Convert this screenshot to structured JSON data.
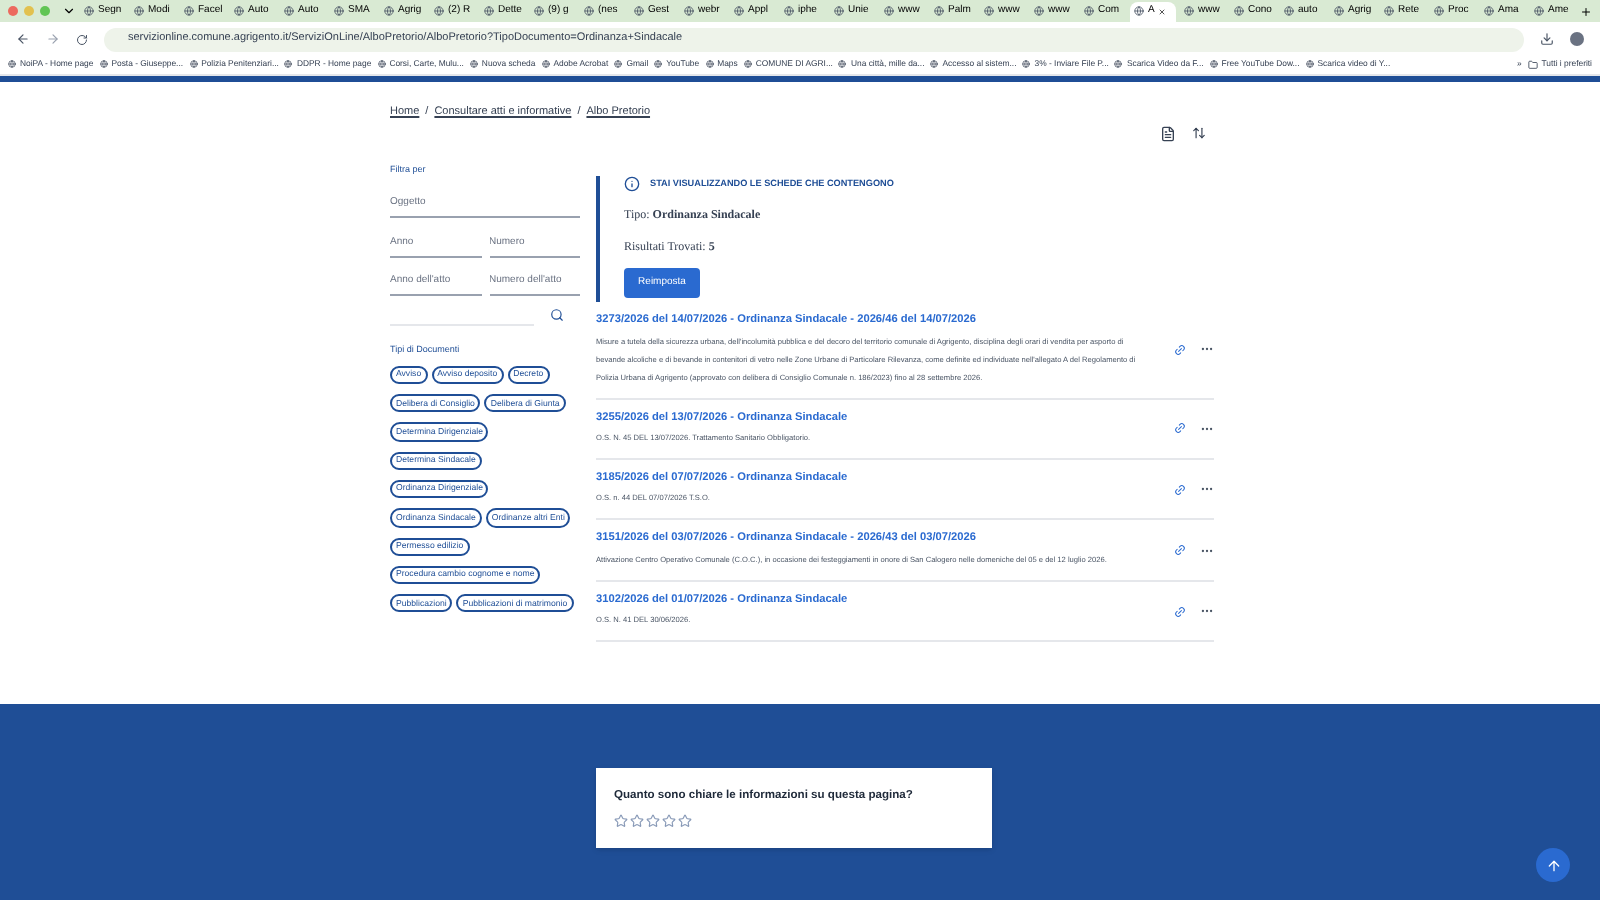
{
  "browser": {
    "tabs": [
      {
        "title": "Segn",
        "selected": false
      },
      {
        "title": "Modi",
        "selected": false
      },
      {
        "title": "Facel",
        "selected": false
      },
      {
        "title": "Auto",
        "selected": false
      },
      {
        "title": "Auto",
        "selected": false
      },
      {
        "title": "SMA",
        "selected": false
      },
      {
        "title": "Agrig",
        "selected": false
      },
      {
        "title": "(2) R",
        "selected": false
      },
      {
        "title": "Dette",
        "selected": false
      },
      {
        "title": "(9) g",
        "selected": false
      },
      {
        "title": "(nes",
        "selected": false
      },
      {
        "title": "Gest",
        "selected": false
      },
      {
        "title": "webr",
        "selected": false
      },
      {
        "title": "Appl",
        "selected": false
      },
      {
        "title": "iphe",
        "selected": false
      },
      {
        "title": "Unie",
        "selected": false
      },
      {
        "title": "www",
        "selected": false
      },
      {
        "title": "Palm",
        "selected": false
      },
      {
        "title": "www",
        "selected": false
      },
      {
        "title": "www",
        "selected": false
      },
      {
        "title": "Com",
        "selected": false
      },
      {
        "title": "A",
        "selected": true
      },
      {
        "title": "www",
        "selected": false
      },
      {
        "title": "Cono",
        "selected": false
      },
      {
        "title": "auto",
        "selected": false
      },
      {
        "title": "Agrig",
        "selected": false
      },
      {
        "title": "Rete",
        "selected": false
      },
      {
        "title": "Proc",
        "selected": false
      },
      {
        "title": "Ama",
        "selected": false
      },
      {
        "title": "Ame",
        "selected": false
      }
    ],
    "url": "servizionline.comune.agrigento.it/ServiziOnLine/AlboPretorio/AlboPretorio?TipoDocumento=Ordinanza+Sindacale",
    "bookmarks": [
      "NoiPA - Home page",
      "Posta - Giuseppe...",
      "Polizia Penitenziari...",
      "DDPR - Home page",
      "Corsi, Carte, Mulu...",
      "Nuova scheda",
      "Adobe Acrobat",
      "Gmail",
      "YouTube",
      "Maps",
      "COMUNE DI AGRI...",
      "Una città, mille da...",
      "Accesso al sistem...",
      "3% - Inviare File P...",
      "Scarica Video da F...",
      "Free YouTube Dow...",
      "Scarica video di Y..."
    ],
    "more_bookmarks": "»",
    "all_bookmarks": "Tutti i preferiti"
  },
  "breadcrumb": [
    "Home",
    "Consultare atti e informative",
    "Albo Pretorio"
  ],
  "breadcrumb_separator": "/",
  "filters": {
    "title": "Filtra per",
    "subject": {
      "placeholder": "Oggetto"
    },
    "year": {
      "placeholder": "Anno"
    },
    "number": {
      "placeholder": "Numero"
    },
    "act_year": {
      "placeholder": "Anno dell'atto"
    },
    "act_number": {
      "placeholder": "Numero dell'atto"
    },
    "types_title": "Tipi di Documenti",
    "types": [
      "Avviso",
      "Avviso deposito",
      "Decreto",
      "Delibera di Consiglio",
      "Delibera di Giunta",
      "Determina Dirigenziale",
      "Determina Sindacale",
      "Ordinanza Dirigenziale",
      "Ordinanza Sindacale",
      "Ordinanze altri Enti",
      "Permesso edilizio",
      "Procedura cambio cognome e nome",
      "Pubblicazioni",
      "Pubblicazioni di matrimonio"
    ]
  },
  "summary": {
    "heading": "STAI VISUALIZZANDO LE SCHEDE CHE CONTENGONO",
    "type": "Tipo: **Ordinanza Sindacale**",
    "count": "Risultati Trovati: **5**",
    "reset": "Reimposta"
  },
  "results": [
    {
      "title": "3273/2026 del 14/07/2026 - Ordinanza Sindacale - 2026/46 del 14/07/2026",
      "description": "Misure a tutela della sicurezza urbana, dell'incolumità pubblica e del decoro del territorio comunale di Agrigento, disciplina degli orari di vendita per asporto di bevande alcoliche e di bevande in contenitori di vetro nelle Zone Urbane di Particolare Rilevanza, come definite ed individuate nell'allegato A del Regolamento di Polizia Urbana di Agrigento (approvato con delibera di Consiglio Comunale n. 186/2023) fino al 28 settembre 2026."
    },
    {
      "title": "3255/2026 del 13/07/2026 - Ordinanza Sindacale",
      "description": "O.S. N. 45 DEL 13/07/2026. Trattamento Sanitario Obbligatorio."
    },
    {
      "title": "3185/2026 del 07/07/2026 - Ordinanza Sindacale",
      "description": "O.S. n. 44 DEL 07/07/2026 T.S.O."
    },
    {
      "title": "3151/2026 del 03/07/2026 - Ordinanza Sindacale - 2026/43 del 03/07/2026",
      "description": "Attivazione Centro Operativo Comunale (C.O.C.), in occasione dei festeggiamenti in onore di San Calogero nelle domeniche del 05 e del 12 luglio 2026."
    },
    {
      "title": "3102/2026 del 01/07/2026 - Ordinanza Sindacale",
      "description": "O.S. N. 41 DEL 30/06/2026."
    }
  ],
  "feedback": {
    "question": "Quanto sono chiare le informazioni su questa pagina?",
    "stars": 0
  }
}
